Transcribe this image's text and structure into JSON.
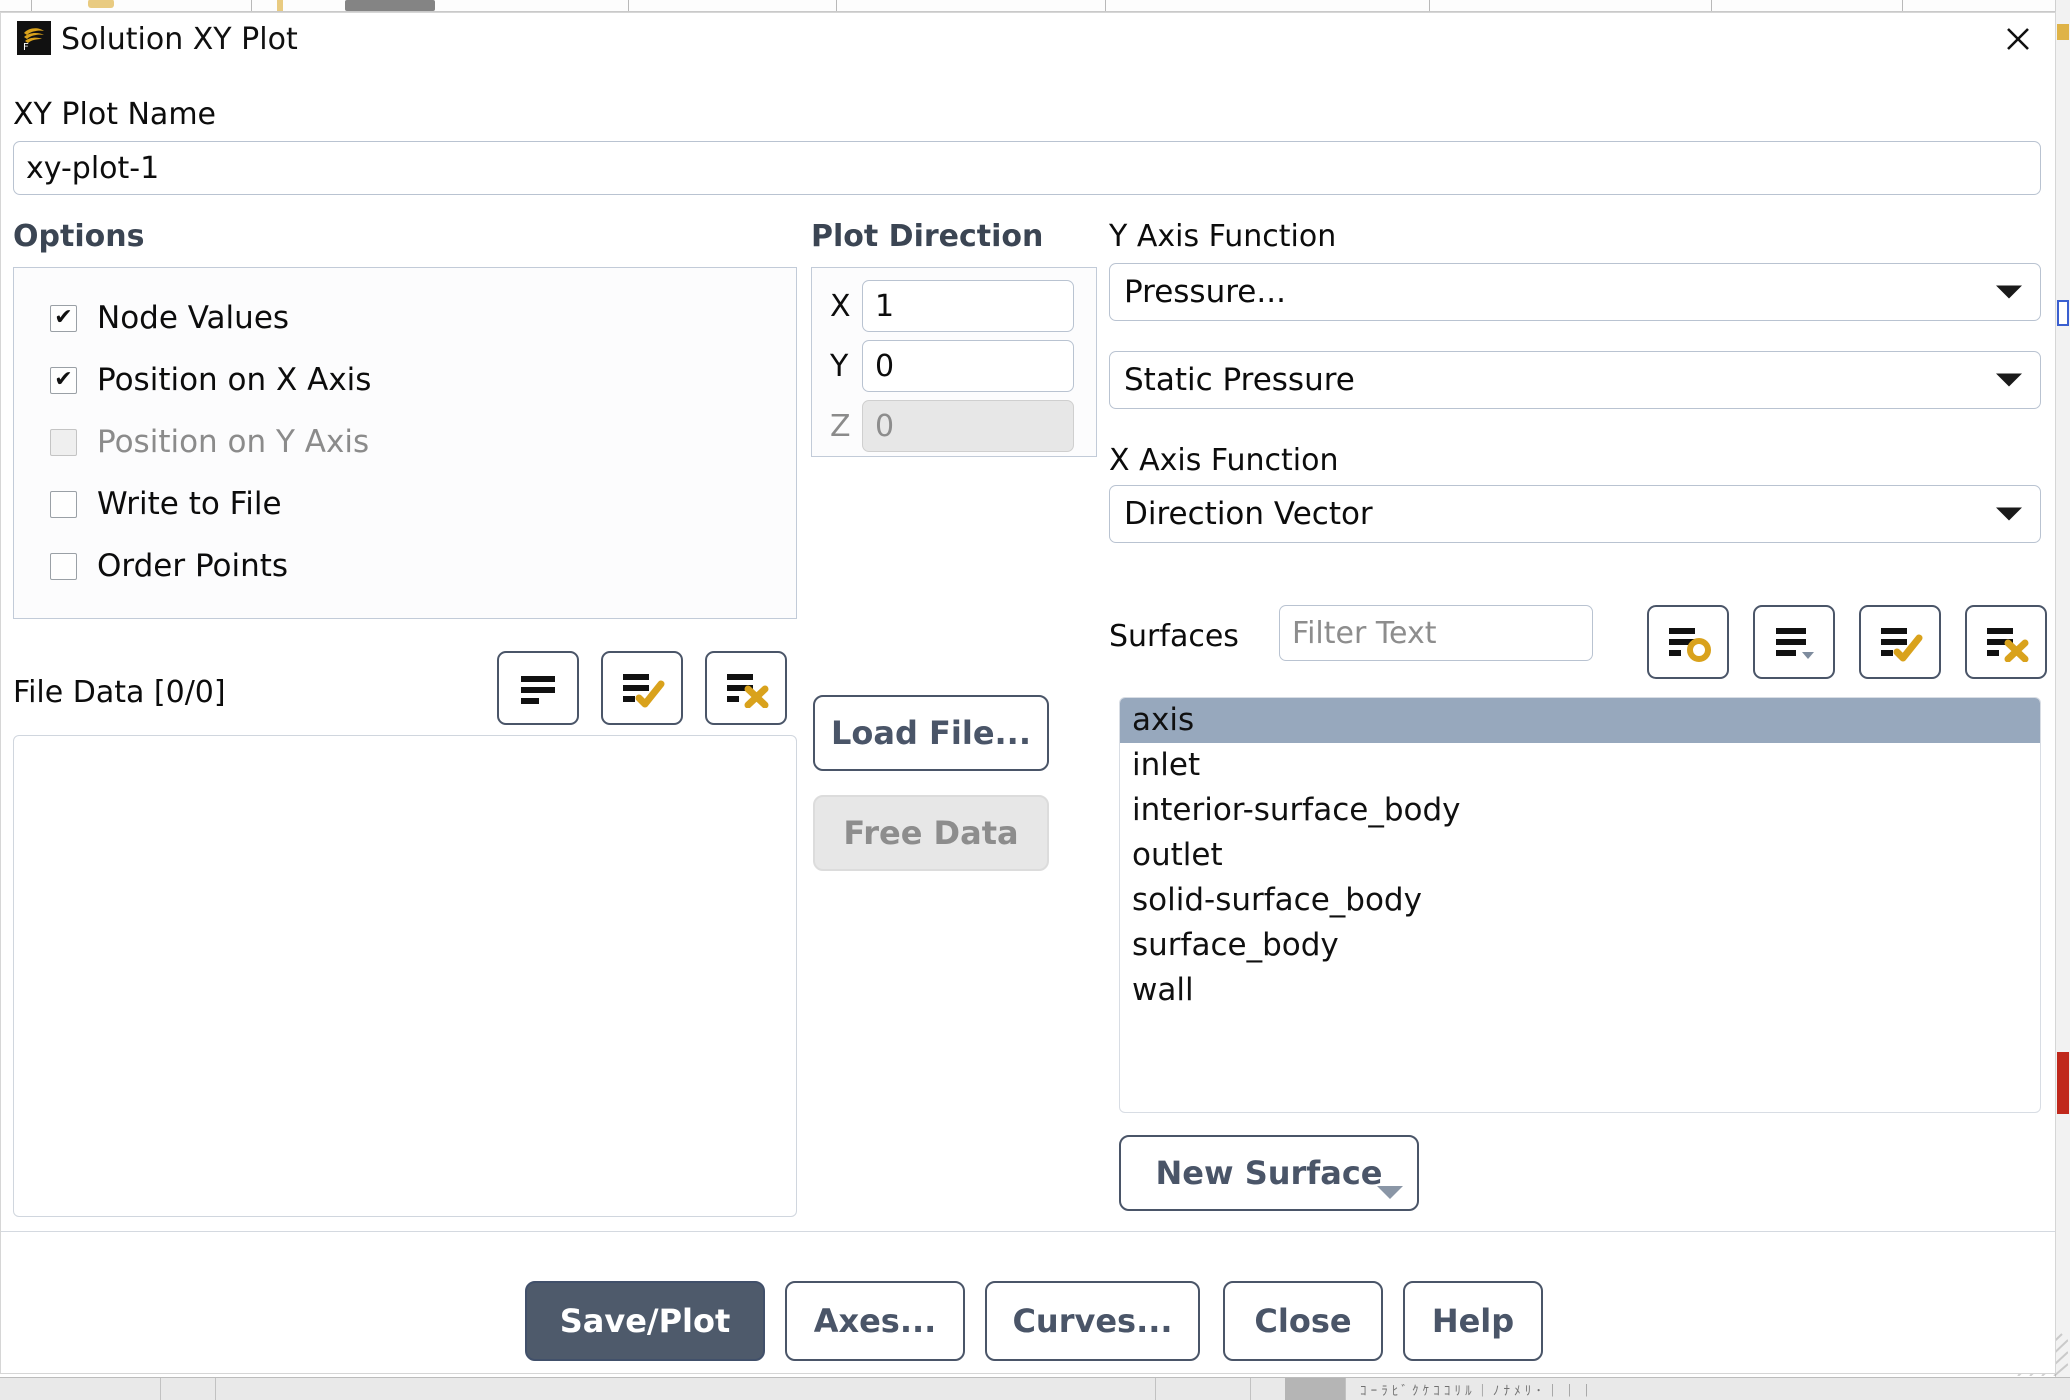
{
  "window": {
    "title": "Solution XY Plot",
    "app_icon": "fluent-logo-icon",
    "close_icon": "close-icon"
  },
  "plot_name": {
    "label": "XY Plot Name",
    "value": "xy-plot-1"
  },
  "options": {
    "title": "Options",
    "items": [
      {
        "label": "Node Values",
        "checked": true,
        "enabled": true
      },
      {
        "label": "Position on X Axis",
        "checked": true,
        "enabled": true
      },
      {
        "label": "Position on Y Axis",
        "checked": false,
        "enabled": false
      },
      {
        "label": "Write to File",
        "checked": false,
        "enabled": true
      },
      {
        "label": "Order Points",
        "checked": false,
        "enabled": true
      }
    ]
  },
  "file_data": {
    "label": "File Data [0/0]",
    "toolbar": [
      {
        "icon": "list-icon",
        "name": "file-data-list-button"
      },
      {
        "icon": "list-check-icon",
        "name": "file-data-select-all-button"
      },
      {
        "icon": "list-cross-icon",
        "name": "file-data-deselect-all-button"
      }
    ],
    "items": []
  },
  "plot_direction": {
    "title": "Plot Direction",
    "axes": [
      {
        "label": "X",
        "value": "1",
        "enabled": true
      },
      {
        "label": "Y",
        "value": "0",
        "enabled": true
      },
      {
        "label": "Z",
        "value": "0",
        "enabled": false
      }
    ]
  },
  "file_buttons": {
    "load_file": "Load File...",
    "free_data": "Free Data",
    "free_data_enabled": false
  },
  "y_axis_function": {
    "label": "Y Axis Function",
    "category": "Pressure...",
    "variable": "Static Pressure"
  },
  "x_axis_function": {
    "label": "X Axis Function",
    "value": "Direction Vector"
  },
  "surfaces": {
    "label": "Surfaces",
    "filter_placeholder": "Filter Text",
    "filter_value": "",
    "toolbar": [
      {
        "icon": "list-ring-icon",
        "name": "surfaces-highlight-button"
      },
      {
        "icon": "list-menu-icon",
        "name": "surfaces-options-button"
      },
      {
        "icon": "list-check-icon",
        "name": "surfaces-select-all-button"
      },
      {
        "icon": "list-cross-icon",
        "name": "surfaces-deselect-all-button"
      }
    ],
    "items": [
      {
        "label": "axis",
        "selected": true
      },
      {
        "label": "inlet",
        "selected": false
      },
      {
        "label": "interior-surface_body",
        "selected": false
      },
      {
        "label": "outlet",
        "selected": false
      },
      {
        "label": "solid-surface_body",
        "selected": false
      },
      {
        "label": "surface_body",
        "selected": false
      },
      {
        "label": "wall",
        "selected": false
      }
    ],
    "new_surface": "New Surface"
  },
  "footer": {
    "buttons": [
      {
        "label": "Save/Plot",
        "style": "primary"
      },
      {
        "label": "Axes...",
        "style": "normal"
      },
      {
        "label": "Curves...",
        "style": "normal"
      },
      {
        "label": "Close",
        "style": "normal"
      },
      {
        "label": "Help",
        "style": "normal"
      }
    ]
  },
  "colors": {
    "accent_gold": "#d9a21c",
    "button_dark": "#4e5a6b",
    "selection_blue": "#97a8bd",
    "border_blue": "#b9c3d1"
  }
}
